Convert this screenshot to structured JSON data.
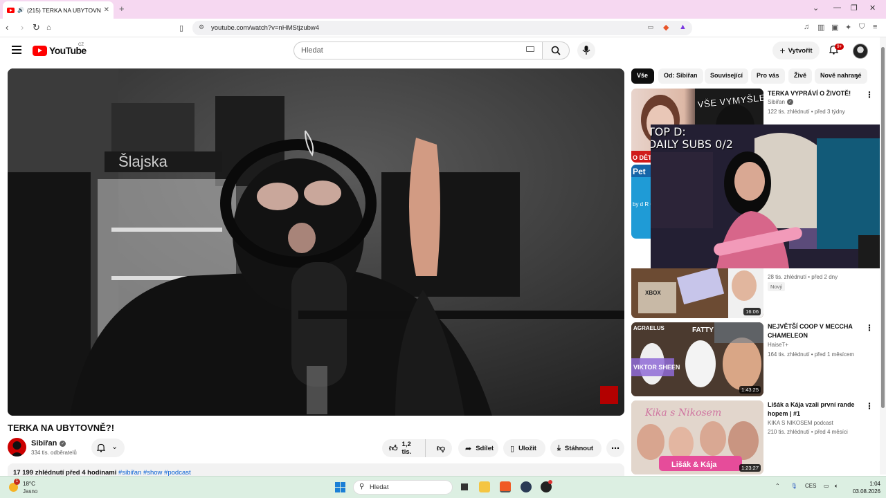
{
  "browser": {
    "tab_title": "(215) TERKA NA UBYTOVNĚ?!",
    "url": "youtube.com/watch?v=nHMStjzubw4"
  },
  "youtube": {
    "logo_text": "YouTube",
    "region": "CZ",
    "search_placeholder": "Hledat",
    "create_label": "Vytvořit",
    "notifications_badge": "9+"
  },
  "video": {
    "title": "TERKA NA UBYTOVNĚ?!",
    "channel": "Sibiřan",
    "subscribers": "334 tis. odběratelů",
    "likes": "1,2 tis.",
    "share_label": "Sdílet",
    "save_label": "Uložit",
    "download_label": "Stáhnout",
    "views_time": "17 199 zhlédnutí  před 4 hodinami",
    "hashtags": "#sibiřan #show #podcast",
    "overlay_text": "TOP D:\nDAILY SUBS 0/2",
    "sign_text": "Šlajska"
  },
  "chips": [
    "Vše",
    "Od: Sibiřan",
    "Související",
    "Pro vás",
    "Živě",
    "Nově nahrané"
  ],
  "recommendations": [
    {
      "title": "TERKA VYPRÁVÍ O ŽIVOTĚ!",
      "channel": "Sibiřan",
      "verified": true,
      "meta": "122 tis. zhlédnutí • před 3 týdny",
      "duration": "",
      "thumb_text": "VŠE VYMYŠLENO!",
      "thumb_text2": "O DĚT"
    },
    {
      "title": "",
      "channel": "",
      "verified": false,
      "meta": "",
      "duration": "",
      "thumb_text": "Pet",
      "thumb_text2": "by d R CA"
    },
    {
      "title": "",
      "channel": "",
      "verified": false,
      "meta": "28 tis. zhlédnutí • před 2 dny",
      "badge": "Nový",
      "duration": "16:06",
      "thumb_text": "XBOX"
    },
    {
      "title": "NEJVĚTŠÍ COOP V MECCHA CHAMELEON",
      "channel": "HaiseT+",
      "verified": false,
      "meta": "164 tis. zhlédnutí • před 1 měsícem",
      "duration": "1:43:25",
      "thumb_text": "AGRAELUS",
      "thumb_text2": "FATTY",
      "thumb_text3": "VIKTOR SHEEN"
    },
    {
      "title": "Lišák a Kája vzali první rande hopem | #1",
      "channel": "KIKA S NIKOSEM podcast",
      "verified": false,
      "meta": "210 tis. zhlédnutí • před 4 měsíci",
      "duration": "1:23:27",
      "thumb_text": "Kika s Nikosem",
      "thumb_text2": "Lišák & Kája"
    }
  ],
  "taskbar": {
    "temperature": "18°C",
    "condition": "Jasno",
    "weather_badge": "1",
    "search_placeholder": "Hledat",
    "language": "CES",
    "time": "1:04",
    "date": "03.08.2026"
  }
}
